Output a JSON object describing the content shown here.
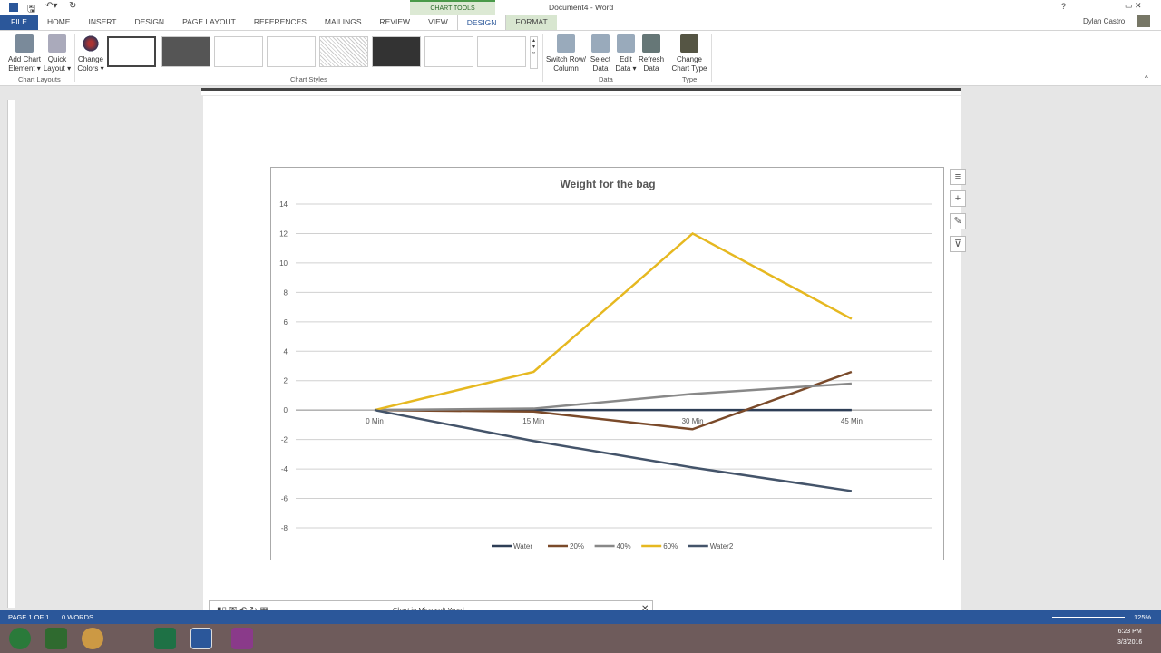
{
  "window": {
    "title": "Document4 - Word",
    "user": "Dylan Castro",
    "context_tab": "CHART TOOLS",
    "help": "?"
  },
  "tabs": [
    "FILE",
    "HOME",
    "INSERT",
    "DESIGN",
    "PAGE LAYOUT",
    "REFERENCES",
    "MAILINGS",
    "REVIEW",
    "VIEW",
    "DESIGN",
    "FORMAT"
  ],
  "ribbon": {
    "add_chart": "Add Chart",
    "add_chart2": "Element ▾",
    "quick": "Quick",
    "quick2": "Layout ▾",
    "change_colors": "Change",
    "change_colors2": "Colors ▾",
    "switch": "Switch Row/",
    "switch2": "Column",
    "select": "Select",
    "select2": "Data",
    "edit": "Edit",
    "edit2": "Data ▾",
    "refresh": "Refresh",
    "refresh2": "Data",
    "change_type": "Change",
    "change_type2": "Chart Type",
    "groups": {
      "layouts": "Chart Layouts",
      "styles": "Chart Styles",
      "data": "Data",
      "type": "Type"
    }
  },
  "chart_data": {
    "type": "line",
    "title": "Weight for the bag",
    "categories": [
      "0 Min",
      "15 Min",
      "30 Min",
      "45 Min"
    ],
    "ylim": [
      -8,
      14
    ],
    "yticks": [
      14,
      12,
      10,
      8,
      6,
      4,
      2,
      0,
      -2,
      -4,
      -6,
      -8
    ],
    "grid": true,
    "legend": "bottom",
    "series": [
      {
        "name": "Water",
        "values": [
          0,
          0,
          0,
          0
        ],
        "color": "#2e3e56"
      },
      {
        "name": "20%",
        "values": [
          0,
          -0.1,
          -1.3,
          2.6
        ],
        "color": "#7a4a2a"
      },
      {
        "name": "40%",
        "values": [
          0,
          0.1,
          1.1,
          1.8
        ],
        "color": "#888888"
      },
      {
        "name": "60%",
        "values": [
          0,
          2.6,
          12,
          6.2
        ],
        "color": "#e6b820"
      },
      {
        "name": "Water2",
        "values": [
          0,
          -2.1,
          -3.9,
          -5.5
        ],
        "color": "#44546a"
      }
    ]
  },
  "status": {
    "page": "PAGE 1 OF 1",
    "words": "0 WORDS",
    "zoom": "125%"
  },
  "popup": {
    "title": "Chart in Microsoft Word",
    "close": "✕"
  },
  "clock": {
    "time": "6:23 PM",
    "date": "3/3/2016"
  }
}
